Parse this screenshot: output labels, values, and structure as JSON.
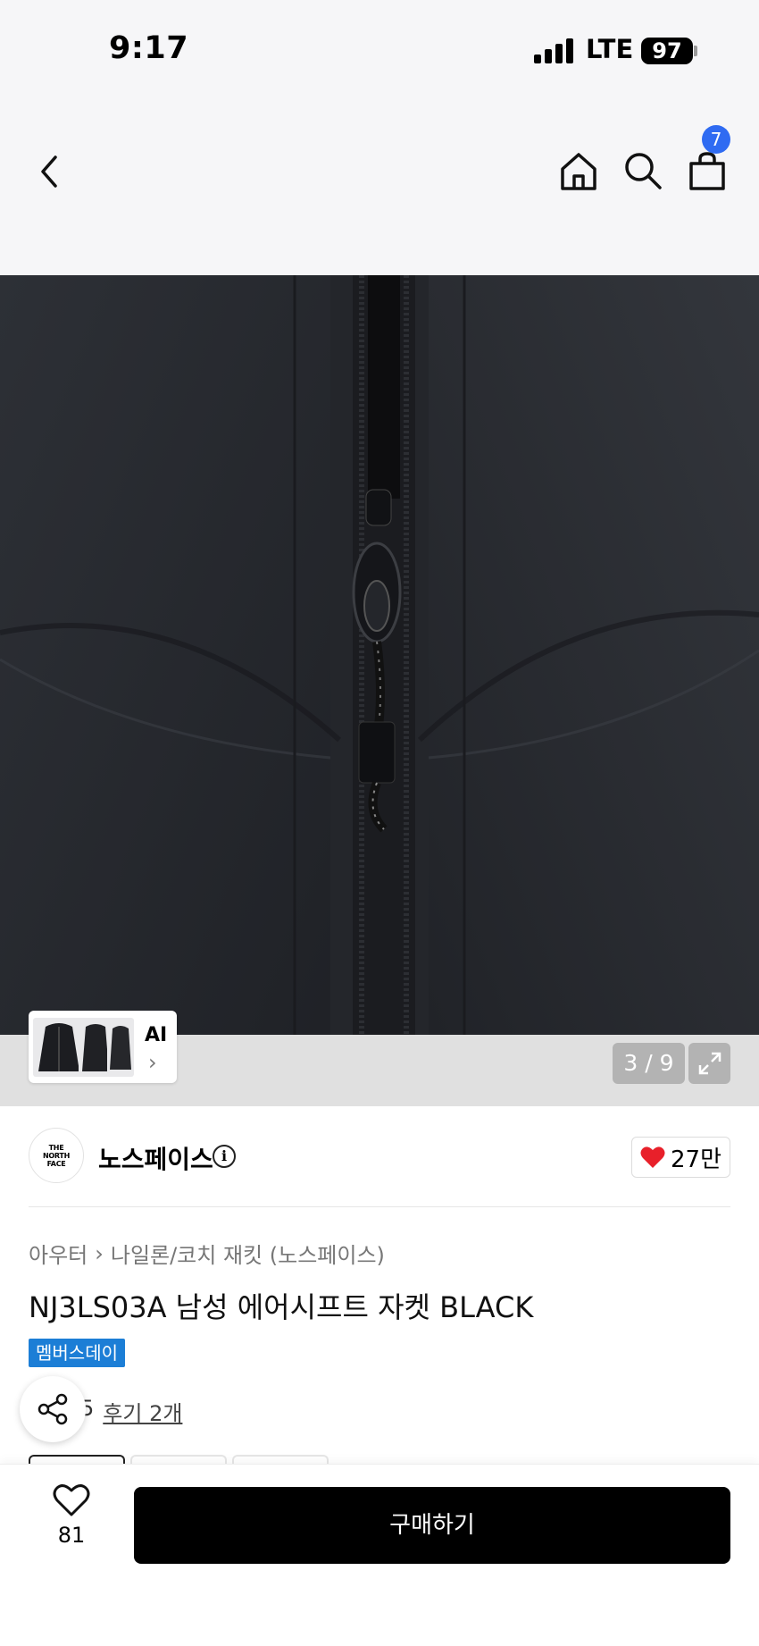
{
  "status_bar": {
    "time": "9:17",
    "network": "LTE",
    "battery": "97"
  },
  "header": {
    "cart_count": "7"
  },
  "gallery": {
    "ai_label": "AI",
    "page_indicator": "3 / 9"
  },
  "brand": {
    "name": "노스페이스",
    "logo_text": [
      "THE",
      "NORTH",
      "FACE"
    ],
    "like_count": "27만"
  },
  "product": {
    "breadcrumb": [
      "아우터",
      "나일론/코치 재킷 (노스페이스)"
    ],
    "title": "NJ3LS03A 남성 에어시프트 자켓 BLACK",
    "badge": "멤버스데이",
    "rating_partial": "5",
    "review_link": "후기 2개"
  },
  "bottom_bar": {
    "wish_count": "81",
    "buy_label": "구매하기"
  },
  "colors": {
    "accent_blue": "#2f6bf2",
    "badge_blue": "#1c7ed6",
    "heart_red": "#e8202a",
    "buy_button": "#000000"
  },
  "icons": [
    "back-arrow-icon",
    "home-icon",
    "search-icon",
    "shopping-bag-icon",
    "expand-icon",
    "info-icon",
    "heart-icon",
    "share-icon"
  ]
}
